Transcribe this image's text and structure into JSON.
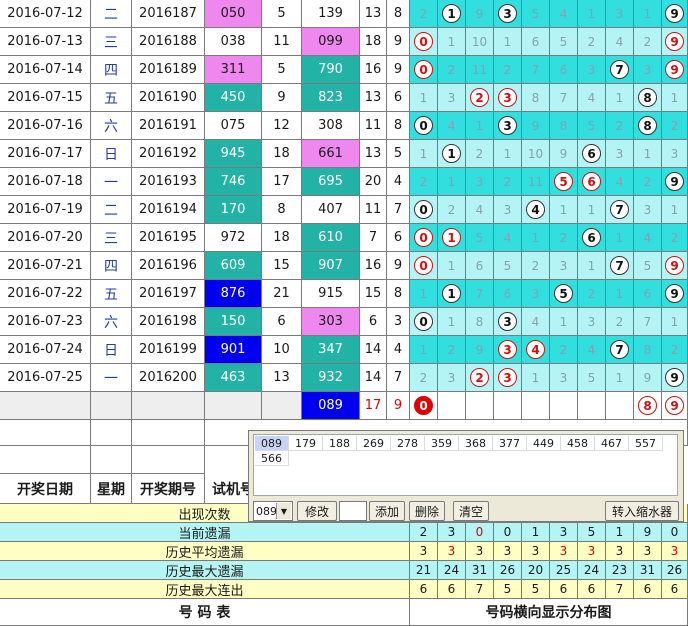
{
  "rows": [
    {
      "date": "2016-07-12",
      "weekday": "二",
      "issue": "2016187",
      "test": "050",
      "span1": "5",
      "draw": "139",
      "sum": "13",
      "span2": "8",
      "dist": [
        {
          "v": "2",
          "t": "m"
        },
        {
          "v": "1",
          "t": "b"
        },
        {
          "v": "9",
          "t": "m"
        },
        {
          "v": "3",
          "t": "b"
        },
        {
          "v": "5",
          "t": "m"
        },
        {
          "v": "4",
          "t": "m"
        },
        {
          "v": "1",
          "t": "m"
        },
        {
          "v": "3",
          "t": "m"
        },
        {
          "v": "1",
          "t": "m"
        },
        {
          "v": "9",
          "t": "b"
        }
      ]
    },
    {
      "date": "2016-07-13",
      "weekday": "三",
      "issue": "2016188",
      "test": "038",
      "span1": "11",
      "draw": "099",
      "sum": "18",
      "span2": "9",
      "dist": [
        {
          "v": "0",
          "t": "r"
        },
        {
          "v": "1",
          "t": "m"
        },
        {
          "v": "10",
          "t": "m"
        },
        {
          "v": "1",
          "t": "m"
        },
        {
          "v": "6",
          "t": "m"
        },
        {
          "v": "5",
          "t": "m"
        },
        {
          "v": "2",
          "t": "m"
        },
        {
          "v": "4",
          "t": "m"
        },
        {
          "v": "2",
          "t": "m"
        },
        {
          "v": "9",
          "t": "r"
        }
      ]
    },
    {
      "date": "2016-07-14",
      "weekday": "四",
      "issue": "2016189",
      "test": "311",
      "span1": "5",
      "draw": "790",
      "sum": "16",
      "span2": "9",
      "dist": [
        {
          "v": "0",
          "t": "r"
        },
        {
          "v": "2",
          "t": "m"
        },
        {
          "v": "11",
          "t": "m"
        },
        {
          "v": "2",
          "t": "m"
        },
        {
          "v": "7",
          "t": "m"
        },
        {
          "v": "6",
          "t": "m"
        },
        {
          "v": "3",
          "t": "m"
        },
        {
          "v": "7",
          "t": "b"
        },
        {
          "v": "3",
          "t": "m"
        },
        {
          "v": "9",
          "t": "r"
        }
      ]
    },
    {
      "date": "2016-07-15",
      "weekday": "五",
      "issue": "2016190",
      "test": "450",
      "span1": "9",
      "draw": "823",
      "sum": "13",
      "span2": "6",
      "dist": [
        {
          "v": "1",
          "t": "m"
        },
        {
          "v": "3",
          "t": "m"
        },
        {
          "v": "2",
          "t": "r"
        },
        {
          "v": "3",
          "t": "r"
        },
        {
          "v": "8",
          "t": "m"
        },
        {
          "v": "7",
          "t": "m"
        },
        {
          "v": "4",
          "t": "m"
        },
        {
          "v": "1",
          "t": "m"
        },
        {
          "v": "8",
          "t": "b"
        },
        {
          "v": "1",
          "t": "m"
        }
      ]
    },
    {
      "date": "2016-07-16",
      "weekday": "六",
      "issue": "2016191",
      "test": "075",
      "span1": "12",
      "draw": "308",
      "sum": "11",
      "span2": "8",
      "dist": [
        {
          "v": "0",
          "t": "b"
        },
        {
          "v": "4",
          "t": "m"
        },
        {
          "v": "1",
          "t": "m"
        },
        {
          "v": "3",
          "t": "b"
        },
        {
          "v": "9",
          "t": "m"
        },
        {
          "v": "8",
          "t": "m"
        },
        {
          "v": "5",
          "t": "m"
        },
        {
          "v": "2",
          "t": "m"
        },
        {
          "v": "8",
          "t": "b"
        },
        {
          "v": "2",
          "t": "m"
        }
      ]
    },
    {
      "date": "2016-07-17",
      "weekday": "日",
      "issue": "2016192",
      "test": "945",
      "span1": "18",
      "draw": "661",
      "sum": "13",
      "span2": "5",
      "dist": [
        {
          "v": "1",
          "t": "m"
        },
        {
          "v": "1",
          "t": "b"
        },
        {
          "v": "2",
          "t": "m"
        },
        {
          "v": "1",
          "t": "m"
        },
        {
          "v": "10",
          "t": "m"
        },
        {
          "v": "9",
          "t": "m"
        },
        {
          "v": "6",
          "t": "b"
        },
        {
          "v": "3",
          "t": "m"
        },
        {
          "v": "1",
          "t": "m"
        },
        {
          "v": "3",
          "t": "m"
        }
      ]
    },
    {
      "date": "2016-07-18",
      "weekday": "一",
      "issue": "2016193",
      "test": "746",
      "span1": "17",
      "draw": "695",
      "sum": "20",
      "span2": "4",
      "dist": [
        {
          "v": "2",
          "t": "m"
        },
        {
          "v": "1",
          "t": "m"
        },
        {
          "v": "3",
          "t": "m"
        },
        {
          "v": "2",
          "t": "m"
        },
        {
          "v": "11",
          "t": "m"
        },
        {
          "v": "5",
          "t": "r"
        },
        {
          "v": "6",
          "t": "r"
        },
        {
          "v": "4",
          "t": "m"
        },
        {
          "v": "2",
          "t": "m"
        },
        {
          "v": "9",
          "t": "b"
        }
      ]
    },
    {
      "date": "2016-07-19",
      "weekday": "二",
      "issue": "2016194",
      "test": "170",
      "span1": "8",
      "draw": "407",
      "sum": "11",
      "span2": "7",
      "dist": [
        {
          "v": "0",
          "t": "b"
        },
        {
          "v": "2",
          "t": "m"
        },
        {
          "v": "4",
          "t": "m"
        },
        {
          "v": "3",
          "t": "m"
        },
        {
          "v": "4",
          "t": "b"
        },
        {
          "v": "1",
          "t": "m"
        },
        {
          "v": "1",
          "t": "m"
        },
        {
          "v": "7",
          "t": "b"
        },
        {
          "v": "3",
          "t": "m"
        },
        {
          "v": "1",
          "t": "m"
        }
      ]
    },
    {
      "date": "2016-07-20",
      "weekday": "三",
      "issue": "2016195",
      "test": "972",
      "span1": "18",
      "draw": "610",
      "sum": "7",
      "span2": "6",
      "dist": [
        {
          "v": "0",
          "t": "r"
        },
        {
          "v": "1",
          "t": "r"
        },
        {
          "v": "5",
          "t": "m"
        },
        {
          "v": "4",
          "t": "m"
        },
        {
          "v": "1",
          "t": "m"
        },
        {
          "v": "2",
          "t": "m"
        },
        {
          "v": "6",
          "t": "b"
        },
        {
          "v": "1",
          "t": "m"
        },
        {
          "v": "4",
          "t": "m"
        },
        {
          "v": "2",
          "t": "m"
        }
      ]
    },
    {
      "date": "2016-07-21",
      "weekday": "四",
      "issue": "2016196",
      "test": "609",
      "span1": "15",
      "draw": "907",
      "sum": "16",
      "span2": "9",
      "dist": [
        {
          "v": "0",
          "t": "r"
        },
        {
          "v": "1",
          "t": "m"
        },
        {
          "v": "6",
          "t": "m"
        },
        {
          "v": "5",
          "t": "m"
        },
        {
          "v": "2",
          "t": "m"
        },
        {
          "v": "3",
          "t": "m"
        },
        {
          "v": "1",
          "t": "m"
        },
        {
          "v": "7",
          "t": "b"
        },
        {
          "v": "5",
          "t": "m"
        },
        {
          "v": "9",
          "t": "r"
        }
      ]
    },
    {
      "date": "2016-07-22",
      "weekday": "五",
      "issue": "2016197",
      "test": "876",
      "span1": "21",
      "draw": "915",
      "sum": "15",
      "span2": "8",
      "dist": [
        {
          "v": "1",
          "t": "m"
        },
        {
          "v": "1",
          "t": "b"
        },
        {
          "v": "7",
          "t": "m"
        },
        {
          "v": "6",
          "t": "m"
        },
        {
          "v": "3",
          "t": "m"
        },
        {
          "v": "5",
          "t": "b"
        },
        {
          "v": "2",
          "t": "m"
        },
        {
          "v": "1",
          "t": "m"
        },
        {
          "v": "6",
          "t": "m"
        },
        {
          "v": "9",
          "t": "b"
        }
      ]
    },
    {
      "date": "2016-07-23",
      "weekday": "六",
      "issue": "2016198",
      "test": "150",
      "span1": "6",
      "draw": "303",
      "sum": "6",
      "span2": "3",
      "dist": [
        {
          "v": "0",
          "t": "b"
        },
        {
          "v": "1",
          "t": "m"
        },
        {
          "v": "8",
          "t": "m"
        },
        {
          "v": "3",
          "t": "b"
        },
        {
          "v": "4",
          "t": "m"
        },
        {
          "v": "1",
          "t": "m"
        },
        {
          "v": "3",
          "t": "m"
        },
        {
          "v": "2",
          "t": "m"
        },
        {
          "v": "7",
          "t": "m"
        },
        {
          "v": "1",
          "t": "m"
        }
      ]
    },
    {
      "date": "2016-07-24",
      "weekday": "日",
      "issue": "2016199",
      "test": "901",
      "span1": "10",
      "draw": "347",
      "sum": "14",
      "span2": "4",
      "dist": [
        {
          "v": "1",
          "t": "m"
        },
        {
          "v": "2",
          "t": "m"
        },
        {
          "v": "9",
          "t": "m"
        },
        {
          "v": "3",
          "t": "r"
        },
        {
          "v": "4",
          "t": "r"
        },
        {
          "v": "2",
          "t": "m"
        },
        {
          "v": "4",
          "t": "m"
        },
        {
          "v": "7",
          "t": "b"
        },
        {
          "v": "8",
          "t": "m"
        },
        {
          "v": "2",
          "t": "m"
        }
      ]
    },
    {
      "date": "2016-07-25",
      "weekday": "一",
      "issue": "2016200",
      "test": "463",
      "span1": "13",
      "draw": "932",
      "sum": "14",
      "span2": "7",
      "dist": [
        {
          "v": "2",
          "t": "m"
        },
        {
          "v": "3",
          "t": "m"
        },
        {
          "v": "2",
          "t": "r"
        },
        {
          "v": "3",
          "t": "r"
        },
        {
          "v": "1",
          "t": "m"
        },
        {
          "v": "3",
          "t": "m"
        },
        {
          "v": "5",
          "t": "m"
        },
        {
          "v": "1",
          "t": "m"
        },
        {
          "v": "9",
          "t": "m"
        },
        {
          "v": "9",
          "t": "b"
        }
      ]
    }
  ],
  "prediction": {
    "draw": "089",
    "sum": "17",
    "span": "9",
    "balls": [
      "0",
      "8",
      "9"
    ]
  },
  "headers": {
    "date": "开奖日期",
    "weekday": "星期",
    "issue": "开奖期号",
    "test": "试机号"
  },
  "stats": [
    {
      "label": "出现次数",
      "values": []
    },
    {
      "label": "当前遗漏",
      "values": [
        "2",
        "3",
        "0",
        "0",
        "1",
        "3",
        "5",
        "1",
        "9",
        "0"
      ]
    },
    {
      "label": "历史平均遗漏",
      "values": [
        "3",
        "3",
        "3",
        "3",
        "3",
        "3",
        "3",
        "3",
        "3",
        "3"
      ]
    },
    {
      "label": "历史最大遗漏",
      "values": [
        "21",
        "24",
        "31",
        "26",
        "20",
        "25",
        "24",
        "23",
        "31",
        "26"
      ]
    },
    {
      "label": "历史最大连出",
      "values": [
        "6",
        "6",
        "7",
        "5",
        "5",
        "6",
        "6",
        "7",
        "6",
        "6"
      ]
    }
  ],
  "footer": {
    "left": "号   码   表",
    "right": "号码横向显示分布图"
  },
  "panel": {
    "items": [
      "089",
      "179",
      "188",
      "269",
      "278",
      "359",
      "368",
      "377",
      "449",
      "458",
      "467",
      "557",
      "566"
    ],
    "select_value": "089",
    "buttons": {
      "modify": "修改",
      "add": "添加",
      "delete": "删除",
      "clear": "清空",
      "shrink": "转入缩水器"
    }
  },
  "colors": {
    "magenta": "#ee88ee",
    "teal": "#22b3a6",
    "blue": "#0000ee",
    "cyan": "#33dede",
    "cyan_light": "#b4f4f4",
    "red": "#e00000",
    "yellow": "#ffffc4",
    "grid": "#7a7a7a"
  }
}
